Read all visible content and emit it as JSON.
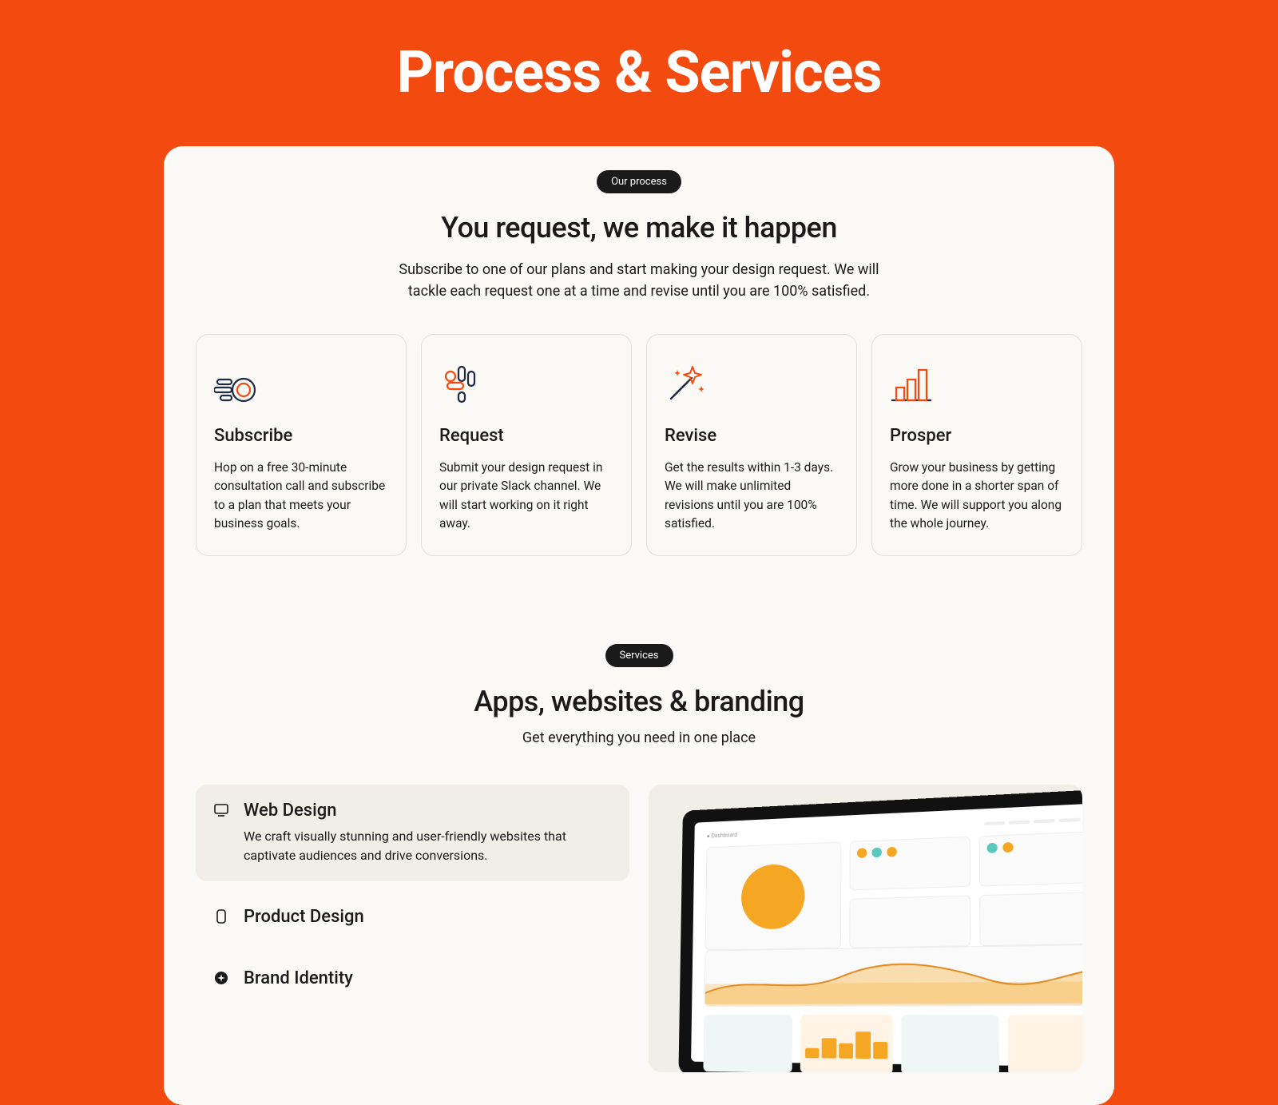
{
  "page_title": "Process & Services",
  "process": {
    "pill": "Our process",
    "heading": "You request, we make it happen",
    "sub": "Subscribe to one of our plans and start making your design request. We will tackle each request one at a time and revise until you are 100% satisfied.",
    "steps": [
      {
        "title": "Subscribe",
        "body": "Hop on a free 30-minute consultation call and subscribe to a plan that meets your business goals."
      },
      {
        "title": "Request",
        "body": "Submit your design request in our private Slack channel. We will start working on it right away."
      },
      {
        "title": "Revise",
        "body": "Get the results within 1-3 days. We will make unlimited revisions until you are 100% satisfied."
      },
      {
        "title": "Prosper",
        "body": "Grow your business by getting more done in a shorter span of time. We will support you along the whole journey."
      }
    ]
  },
  "services": {
    "pill": "Services",
    "heading": "Apps, websites & branding",
    "sub": "Get everything you need in one place",
    "items": [
      {
        "title": "Web Design",
        "body": "We craft visually stunning and user-friendly websites that captivate audiences and drive conversions.",
        "active": true
      },
      {
        "title": "Product Design"
      },
      {
        "title": "Brand Identity"
      }
    ]
  }
}
